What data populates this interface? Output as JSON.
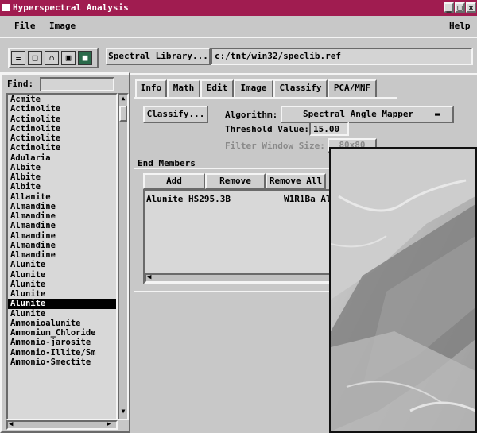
{
  "window": {
    "title": "Hyperspectral Analysis",
    "title_color": "#a01c50"
  },
  "menu": {
    "file": "File",
    "image": "Image",
    "help": "Help"
  },
  "toolbar": {
    "icons": [
      "open-icon",
      "new-icon",
      "folder-icon",
      "save-icon",
      "image-icon"
    ],
    "spectral_library_button": "Spectral Library...",
    "spectral_library_path": "c:/tnt/win32/speclib.ref"
  },
  "find": {
    "label": "Find:",
    "value": ""
  },
  "minerals": [
    "Acmite",
    "Actinolite",
    "Actinolite",
    "Actinolite",
    "Actinolite",
    "Actinolite",
    "Adularia",
    "Albite",
    "Albite",
    "Albite",
    "Allanite",
    "Almandine",
    "Almandine",
    "Almandine",
    "Almandine",
    "Almandine",
    "Almandine",
    "Alunite",
    "Alunite",
    "Alunite",
    "Alunite",
    "Alunite",
    "Alunite",
    "Ammonioalunite",
    "Ammonium_Chloride",
    "Ammonio-jarosite",
    "Ammonio-Illite/Sm",
    "Ammonio-Smectite"
  ],
  "selected_index": 21,
  "tabs": [
    "Info",
    "Math",
    "Edit",
    "Image",
    "Classify",
    "PCA/MNF"
  ],
  "active_tab": "Classify",
  "classify": {
    "button": "Classify...",
    "algorithm_label": "Algorithm:",
    "algorithm_value": "Spectral Angle Mapper",
    "threshold_label": "Threshold Value:",
    "threshold_value": "15.00",
    "filter_label": "Filter Window Size:",
    "filter_value": "80x80"
  },
  "end_members": {
    "heading": "End Members",
    "add": "Add",
    "remove": "Remove",
    "remove_all": "Remove All",
    "rows": [
      {
        "name": "Alunite HS295.3B",
        "id": "W1R1Ba Al"
      }
    ]
  }
}
